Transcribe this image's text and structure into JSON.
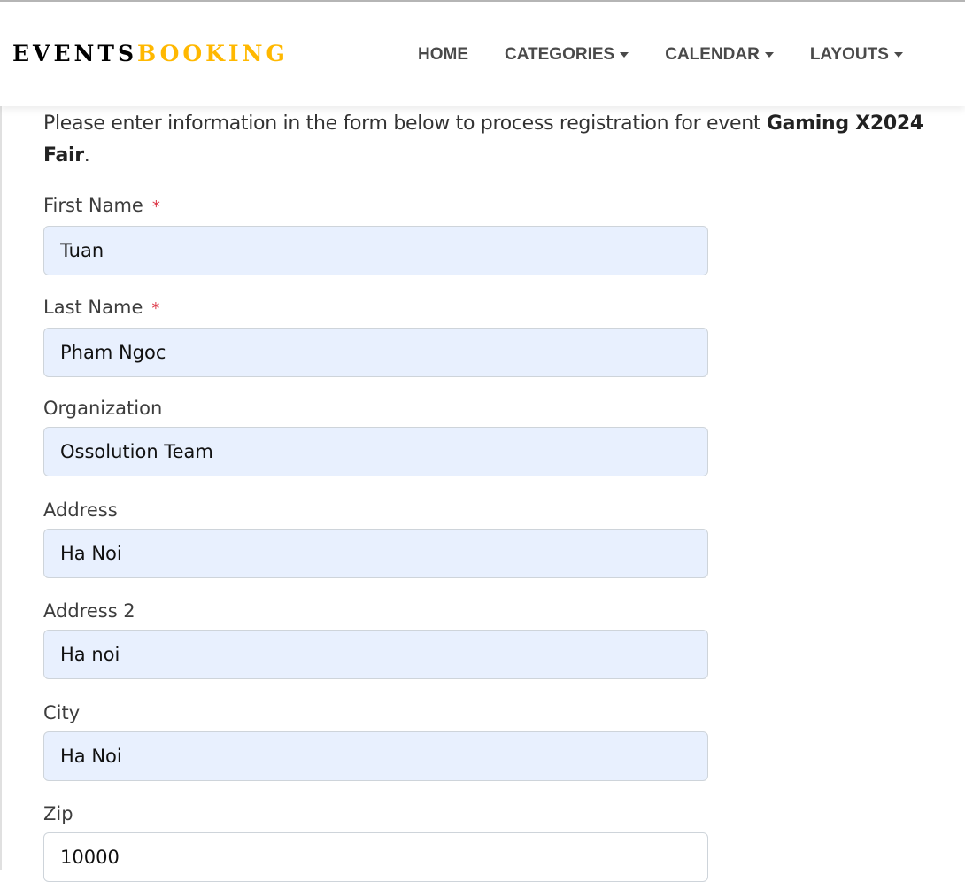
{
  "header": {
    "logo_part1": "EVENTS",
    "logo_part2": "BOOKING",
    "colors": {
      "logo_dark": "#000000",
      "logo_accent": "#ffb800"
    },
    "nav": [
      {
        "label": "HOME",
        "dropdown": false
      },
      {
        "label": "CATEGORIES",
        "dropdown": true
      },
      {
        "label": "CALENDAR",
        "dropdown": true
      },
      {
        "label": "LAYOUTS",
        "dropdown": true
      }
    ]
  },
  "form": {
    "intro_text": "Please enter information in the form below to process registration for event ",
    "event_name": "Gaming X2024 Fair",
    "intro_suffix": ".",
    "required_marker": "*",
    "fields": [
      {
        "label": "First Name",
        "required": true,
        "value": "Tuan",
        "autofilled": true
      },
      {
        "label": "Last Name",
        "required": true,
        "value": "Pham Ngoc",
        "autofilled": true
      },
      {
        "label": "Organization",
        "required": false,
        "value": "Ossolution Team",
        "autofilled": true
      },
      {
        "label": "Address",
        "required": false,
        "value": "Ha Noi",
        "autofilled": true
      },
      {
        "label": "Address 2",
        "required": false,
        "value": "Ha noi",
        "autofilled": true
      },
      {
        "label": "City",
        "required": false,
        "value": "Ha Noi",
        "autofilled": true
      },
      {
        "label": "Zip",
        "required": false,
        "value": "10000",
        "autofilled": false
      }
    ]
  }
}
